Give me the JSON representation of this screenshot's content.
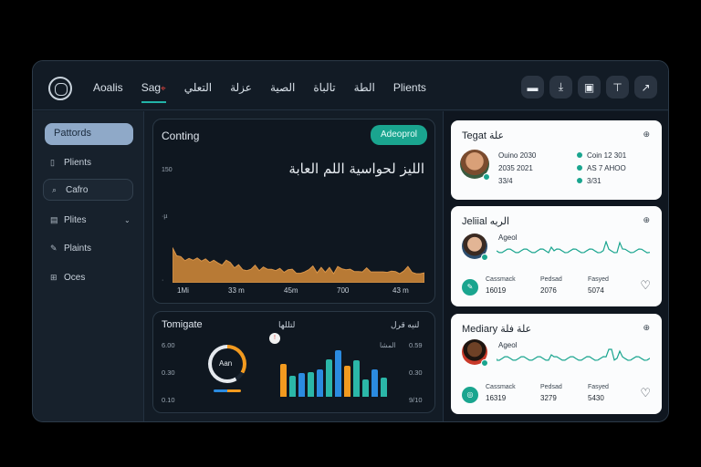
{
  "nav": {
    "items": [
      "Aoalis",
      "Sag",
      "ﺍﻟﺘﻌﻠﻲ",
      "ﻋﺰﻟﺔ",
      "ﺍﻟﺼﻴﺔ",
      "ﺗﺎﻟﺒﺎﺓ",
      "ﺍﻟﻄﺔ",
      "Plients"
    ],
    "active_index": 1,
    "active_marker": "⌖",
    "icons": [
      "chat-icon",
      "download-icon",
      "folder-icon",
      "pin-icon",
      "share-icon"
    ]
  },
  "sidebar": {
    "primary": "Pattords",
    "items": [
      {
        "label": "Plients",
        "icon": "document-icon"
      },
      {
        "label": "Cafro",
        "icon": "search-icon"
      },
      {
        "label": "Plites",
        "icon": "calendar-icon"
      },
      {
        "label": "Plaints",
        "icon": "pen-icon"
      },
      {
        "label": "Oces",
        "icon": "grid-icon"
      }
    ]
  },
  "main_chart": {
    "title": "Conting",
    "badge": "Adeoprol",
    "heading_ar": "ﺍﻟﻠﻴﺰ ﻟﺤﻮﺍﺳﻴﺔ ﺍﻟﻠﻢ ﺍﻟﻌﺎﺑﺔ",
    "y_ticks": [
      "150",
      "·µ",
      "·"
    ],
    "x_ticks": [
      "1Mi",
      "33 m",
      "45m",
      "700",
      "43 m"
    ]
  },
  "chart_data": {
    "type": "area",
    "y": [
      78,
      60,
      58,
      49,
      54,
      50,
      55,
      48,
      53,
      45,
      50,
      44,
      39,
      50,
      45,
      33,
      40,
      29,
      27,
      30,
      39,
      27,
      35,
      30,
      30,
      27,
      32,
      23,
      29,
      30,
      21,
      21,
      24,
      29,
      37,
      22,
      34,
      23,
      34,
      20,
      36,
      31,
      29,
      30,
      25,
      25,
      24,
      33,
      24,
      24,
      24,
      24,
      23,
      26,
      25,
      20,
      26,
      36,
      23,
      20,
      20,
      22
    ],
    "color": "#b87a35",
    "ylim": [
      0,
      150
    ],
    "grid": false
  },
  "bottom_panel": {
    "title": "Tomigate",
    "sub_mid": "ﻟﺘﻠﻠﻬﺎ",
    "sub_right": "ﻟﻨﻴﻪ ﻗﺮﻝ",
    "left_ticks": [
      "6.00",
      "0.30",
      "0.10"
    ],
    "right_ticks": [
      "0.59",
      "0.30",
      "9/10"
    ],
    "right_top_label": "ﺍﻟﻤﺸﺎ",
    "donut_label": "Aan",
    "donut_value": 0.33,
    "alert_glyph": "!",
    "bars": [
      {
        "value": 0.65,
        "color": "#f29a1f"
      },
      {
        "value": 0.42,
        "color": "#2bb7a8"
      },
      {
        "value": 0.48,
        "color": "#2b8be0"
      },
      {
        "value": 0.5,
        "color": "#2bb7a8"
      },
      {
        "value": 0.55,
        "color": "#2b8be0"
      },
      {
        "value": 0.75,
        "color": "#2bb7a8"
      },
      {
        "value": 0.92,
        "color": "#2b8be0"
      },
      {
        "value": 0.62,
        "color": "#f29a1f"
      },
      {
        "value": 0.72,
        "color": "#2bb7a8"
      },
      {
        "value": 0.35,
        "color": "#2bb7a8"
      },
      {
        "value": 0.55,
        "color": "#2b8be0"
      },
      {
        "value": 0.38,
        "color": "#2bb7a8"
      }
    ]
  },
  "cards": [
    {
      "title": "Tegat ﻋﻠﺔ",
      "left": [
        "Ouino 2030",
        "2035 2021",
        "33/4"
      ],
      "right": [
        "Coin 12 301",
        "AS 7 AHOO",
        "3/31"
      ]
    },
    {
      "title": "Jeliial ﺍﻟﺮﻳﻪ",
      "agent": "Ageol",
      "stats": [
        {
          "label": "Cassmack",
          "value": "16019"
        },
        {
          "label": "Pedsad",
          "value": "2076"
        },
        {
          "label": "Fasyed",
          "value": "5074"
        }
      ]
    },
    {
      "title": "Mediary ﻋﻠﺔ ﻓﻠﺔ",
      "agent": "Ageol",
      "stats": [
        {
          "label": "Cassmack",
          "value": "16319"
        },
        {
          "label": "Pedsad",
          "value": "3279"
        },
        {
          "label": "Fasyed",
          "value": "5430"
        }
      ]
    }
  ]
}
